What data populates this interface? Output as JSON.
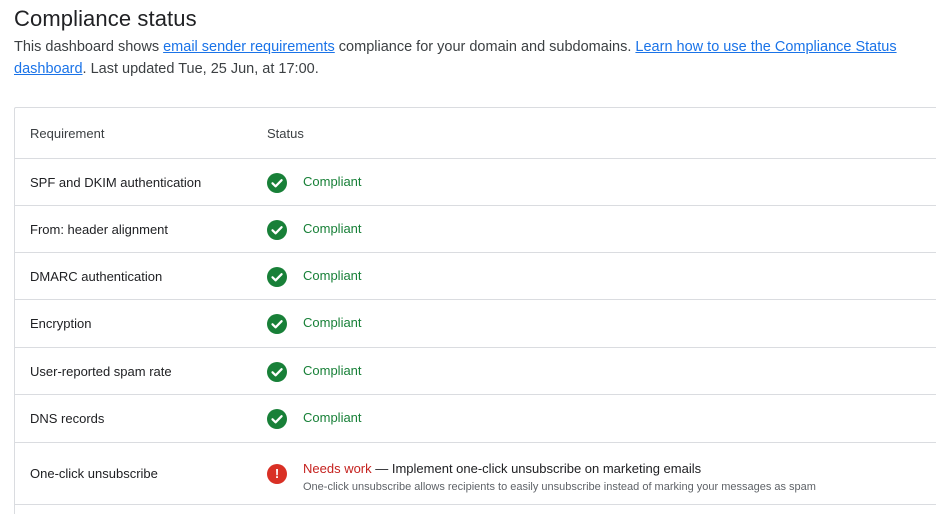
{
  "header": {
    "title": "Compliance status",
    "desc_prefix": "This dashboard shows ",
    "desc_link1": "email sender requirements",
    "desc_mid": " compliance for your domain and subdomains. ",
    "desc_link2": "Learn how to use the Compliance Status dashboard",
    "desc_suffix": ". Last updated Tue, 25 Jun, at 17:00."
  },
  "table": {
    "col_requirement": "Requirement",
    "col_status": "Status",
    "rows": [
      {
        "requirement": "SPF and DKIM authentication",
        "status": "Compliant"
      },
      {
        "requirement": "From: header alignment",
        "status": "Compliant"
      },
      {
        "requirement": "DMARC authentication",
        "status": "Compliant"
      },
      {
        "requirement": "Encryption",
        "status": "Compliant"
      },
      {
        "requirement": "User-reported spam rate",
        "status": "Compliant"
      },
      {
        "requirement": "DNS records",
        "status": "Compliant"
      },
      {
        "requirement": "One-click unsubscribe",
        "status": "Needs work",
        "detail": " — Implement one-click unsubscribe on marketing emails",
        "subtext": "One-click unsubscribe allows recipients to easily unsubscribe instead of marking your messages as spam"
      }
    ]
  },
  "icons": {
    "ok": "check-circle-icon",
    "error": "error-circle-icon"
  },
  "colors": {
    "compliant": "#188038",
    "needs_work": "#d93025",
    "link": "#1a73e8",
    "border": "#dadce0"
  }
}
